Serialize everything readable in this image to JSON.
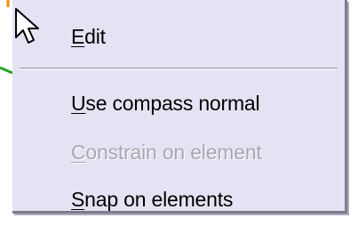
{
  "menu": {
    "items": [
      {
        "accel": "E",
        "rest": "dit",
        "enabled": true
      },
      {
        "accel": "U",
        "rest": "se compass normal",
        "enabled": true
      },
      {
        "accel": "C",
        "rest": "onstrain on element",
        "enabled": false
      },
      {
        "accel": "S",
        "rest": "nap on elements",
        "enabled": true
      }
    ]
  },
  "colors": {
    "menu_bg": "#e3e3f3",
    "disabled_text": "#a7a7b3",
    "bg_stroke_orange": "#ff8a00",
    "bg_stroke_red": "#e23a3a",
    "bg_stroke_green": "#22a322"
  },
  "icons": {
    "cursor": "arrow-cursor-icon"
  }
}
